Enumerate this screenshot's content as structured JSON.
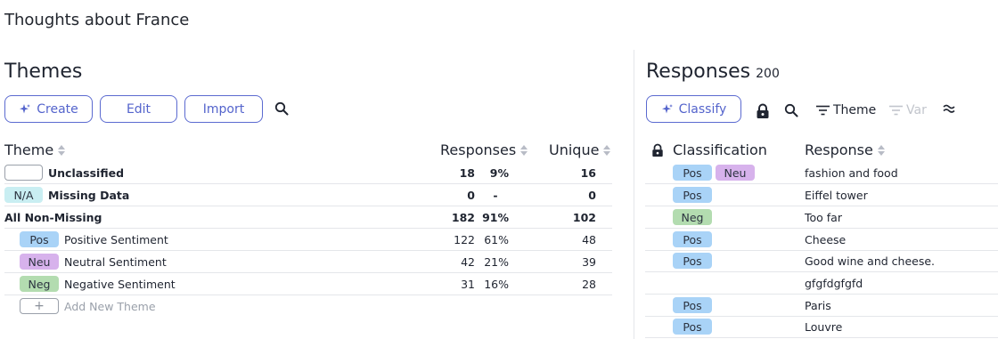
{
  "page_title": "Thoughts about France",
  "themes": {
    "title": "Themes",
    "buttons": {
      "create": "Create",
      "edit": "Edit",
      "import": "Import"
    },
    "columns": {
      "theme": "Theme",
      "responses": "Responses",
      "unique": "Unique"
    },
    "rows": [
      {
        "badge": "",
        "badge_type": "blank",
        "name": "Unclassified",
        "bold": true,
        "responses": "18",
        "pct": "9%",
        "unique": "16"
      },
      {
        "badge": "N/A",
        "badge_type": "na",
        "name": "Missing Data",
        "bold": true,
        "responses": "0",
        "pct": "-",
        "unique": "0"
      },
      {
        "badge": "",
        "badge_type": "none",
        "name": "All Non-Missing",
        "bold": true,
        "responses": "182",
        "pct": "91%",
        "unique": "102"
      },
      {
        "badge": "Pos",
        "badge_type": "pos",
        "name": "Positive Sentiment",
        "bold": false,
        "responses": "122",
        "pct": "61%",
        "unique": "48"
      },
      {
        "badge": "Neu",
        "badge_type": "neu",
        "name": "Neutral Sentiment",
        "bold": false,
        "responses": "42",
        "pct": "21%",
        "unique": "39"
      },
      {
        "badge": "Neg",
        "badge_type": "neg",
        "name": "Negative Sentiment",
        "bold": false,
        "responses": "31",
        "pct": "16%",
        "unique": "28"
      }
    ],
    "add_new": {
      "symbol": "+",
      "label": "Add New Theme"
    }
  },
  "responses": {
    "title": "Responses",
    "count": "200",
    "classify_label": "Classify",
    "theme_filter": "Theme",
    "var_filter": "Var",
    "columns": {
      "classification": "Classification",
      "response": "Response"
    },
    "rows": [
      {
        "tags": [
          "Pos",
          "Neu"
        ],
        "text": "fashion and food"
      },
      {
        "tags": [
          "Pos"
        ],
        "text": "Eiffel tower"
      },
      {
        "tags": [
          "Neg"
        ],
        "text": "Too far"
      },
      {
        "tags": [
          "Pos"
        ],
        "text": "Cheese"
      },
      {
        "tags": [
          "Pos"
        ],
        "text": "Good wine and cheese."
      },
      {
        "tags": [],
        "text": "gfgfdgfgfd"
      },
      {
        "tags": [
          "Pos"
        ],
        "text": "Paris"
      },
      {
        "tags": [
          "Pos"
        ],
        "text": "Louvre"
      }
    ]
  },
  "icons": {
    "create": "sparkle-icon",
    "classify": "sparkle-icon",
    "search": "search-icon",
    "lock": "lock-icon",
    "filter": "filter-icon",
    "approx": "approx-icon"
  },
  "colors": {
    "accent": "#5464cc",
    "pos": "#a9d3f7",
    "neu": "#d7b2ec",
    "neg": "#b3dcb0",
    "na": "#c9eef2"
  }
}
